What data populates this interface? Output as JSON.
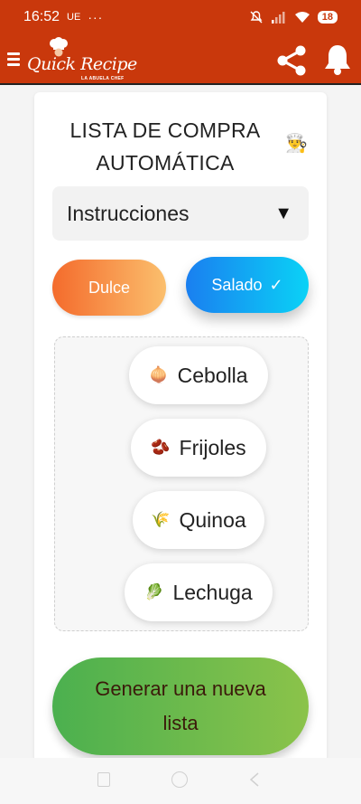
{
  "status_bar": {
    "time": "16:52",
    "carrier": "UE",
    "dots": "···",
    "battery": "18"
  },
  "app_bar": {
    "logo_text": "Quick Recipe",
    "logo_subtitle": "LA ABUELA CHEF",
    "icons": [
      "menu-icon",
      "share-icon",
      "bell-icon"
    ]
  },
  "card": {
    "title": "LISTA DE COMPRA AUTOMÁTICA",
    "dropdown": {
      "selected": "Instrucciones",
      "arrow": "▼"
    },
    "buttons": {
      "dulce": "Dulce",
      "salado": "Salado",
      "salado_check": "✓"
    },
    "ingredients": [
      {
        "emoji": "🧅",
        "name": "Cebolla"
      },
      {
        "emoji": "🫘",
        "name": "Frijoles"
      },
      {
        "emoji": "🌾",
        "name": "Quinoa"
      },
      {
        "emoji": "🥬",
        "name": "Lechuga"
      }
    ],
    "generate_button": "Generar una nueva lista"
  },
  "colors": {
    "brand": "#c9380c",
    "dulce_start": "#f46b2c",
    "dulce_end": "#fbbf6d",
    "salado_start": "#1a7ff0",
    "salado_end": "#0ad2f6",
    "generate_start": "#4bb04f",
    "generate_end": "#8bc34a"
  }
}
